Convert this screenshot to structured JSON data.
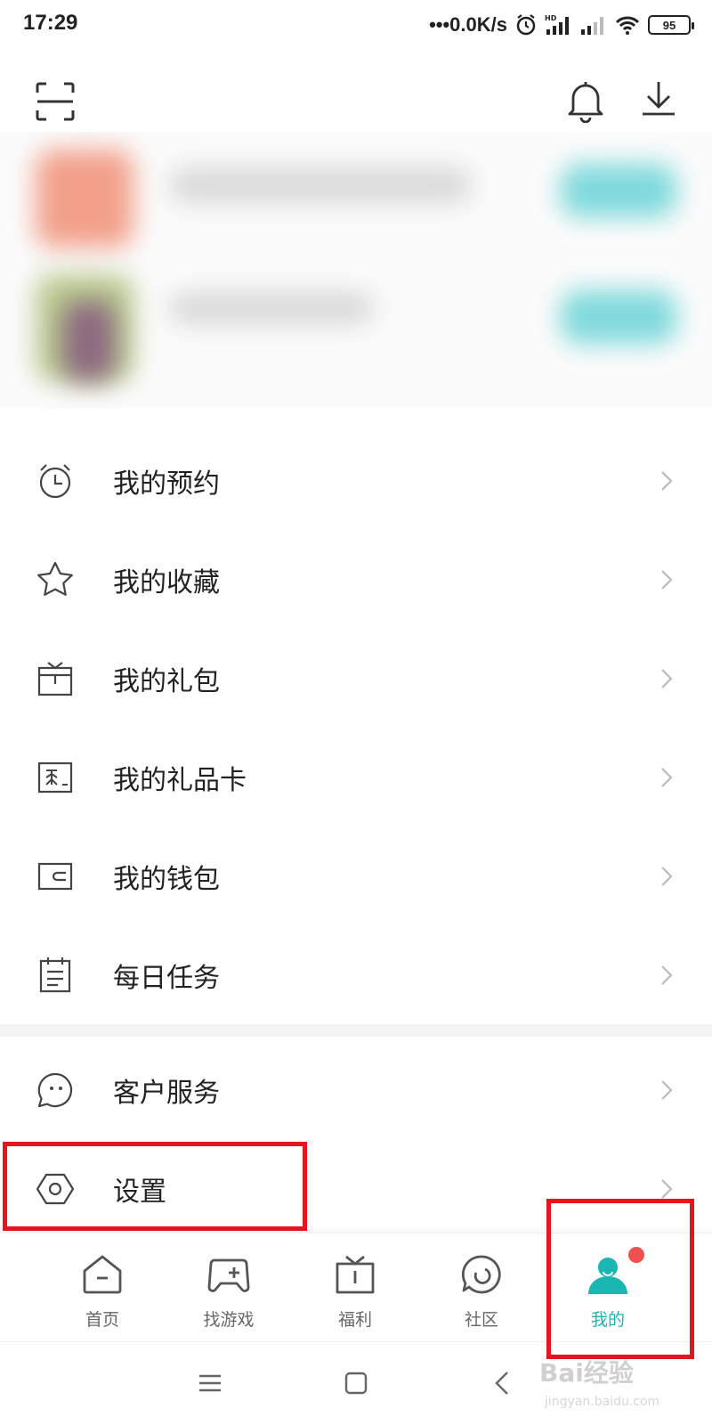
{
  "status_bar": {
    "time": "17:29",
    "network_speed": "•••0.0K/s",
    "battery": "95"
  },
  "menu": {
    "items": [
      {
        "label": "我的预约",
        "icon": "alarm-clock-icon"
      },
      {
        "label": "我的收藏",
        "icon": "star-icon"
      },
      {
        "label": "我的礼包",
        "icon": "gift-box-icon"
      },
      {
        "label": "我的礼品卡",
        "icon": "gift-card-icon"
      },
      {
        "label": "我的钱包",
        "icon": "wallet-icon"
      },
      {
        "label": "每日任务",
        "icon": "clipboard-icon"
      }
    ],
    "items_2": [
      {
        "label": "客户服务",
        "icon": "chat-bubble-icon"
      },
      {
        "label": "设置",
        "icon": "hexagon-gear-icon"
      }
    ]
  },
  "bottom_nav": {
    "items": [
      {
        "label": "首页",
        "icon": "home-icon"
      },
      {
        "label": "找游戏",
        "icon": "gamepad-icon"
      },
      {
        "label": "福利",
        "icon": "gift-icon"
      },
      {
        "label": "社区",
        "icon": "community-icon"
      },
      {
        "label": "我的",
        "icon": "user-icon",
        "active": true
      }
    ]
  },
  "watermark": {
    "text": "Bai经验",
    "sub": "jingyan.baidu.com"
  },
  "colors": {
    "accent": "#19b6b2",
    "highlight": "#e8141c",
    "badge": "#ef5050"
  }
}
